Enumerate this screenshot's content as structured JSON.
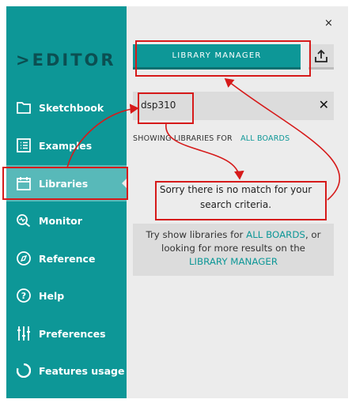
{
  "sidebar": {
    "logo": "EDITOR",
    "items": [
      {
        "label": "Sketchbook",
        "icon": "folder-icon"
      },
      {
        "label": "Examples",
        "icon": "list-icon"
      },
      {
        "label": "Libraries",
        "icon": "libraries-icon",
        "active": true
      },
      {
        "label": "Monitor",
        "icon": "monitor-icon"
      },
      {
        "label": "Reference",
        "icon": "compass-icon"
      },
      {
        "label": "Help",
        "icon": "help-icon"
      },
      {
        "label": "Preferences",
        "icon": "sliders-icon"
      },
      {
        "label": "Features usage",
        "icon": "pie-icon"
      }
    ]
  },
  "panel": {
    "close": "×",
    "library_manager_label": "LIBRARY MANAGER",
    "search_value": "dsp310",
    "clear": "✕",
    "showing_prefix": "SHOWING LIBRARIES FOR",
    "showing_link": "ALL BOARDS",
    "no_match_line1": "Sorry there is no match for your",
    "no_match_line2": "search criteria.",
    "try_part1": "Try show libraries for",
    "try_link1": "ALL BOARDS",
    "try_part2": ", or",
    "try_part3": "looking for more results on the",
    "try_link2": "LIBRARY MANAGER"
  },
  "colors": {
    "sidebar": "#0d9797",
    "active": "#58b9b9",
    "panel": "#ececec",
    "annotation": "#d61a1a"
  }
}
